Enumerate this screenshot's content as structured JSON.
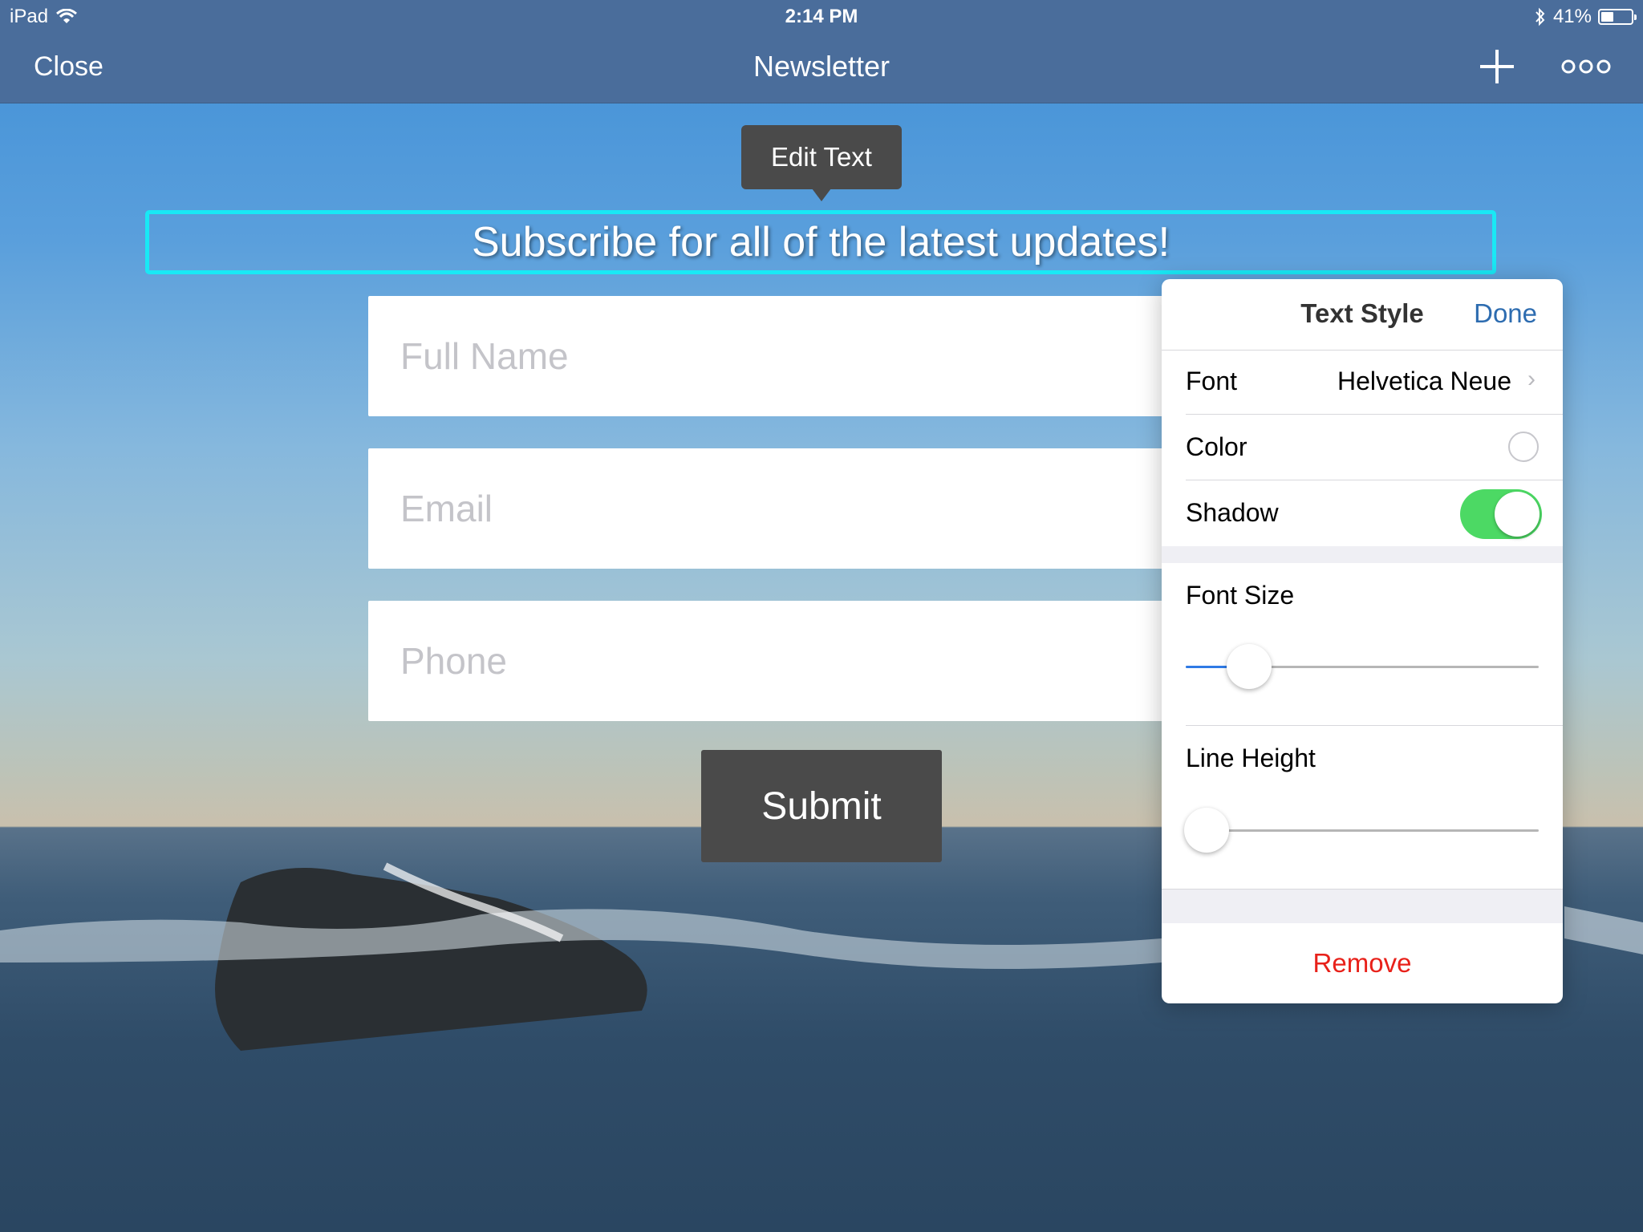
{
  "status_bar": {
    "device": "iPad",
    "time": "2:14 PM",
    "battery": "41%",
    "battery_level": 0.41
  },
  "nav": {
    "close_label": "Close",
    "title": "Newsletter"
  },
  "canvas": {
    "tooltip": "Edit Text",
    "headline": "Subscribe for all of the latest updates!",
    "fields": [
      {
        "placeholder": "Full Name"
      },
      {
        "placeholder": "Email"
      },
      {
        "placeholder": "Phone"
      }
    ],
    "submit_label": "Submit"
  },
  "text_style_panel": {
    "title": "Text Style",
    "done_label": "Done",
    "font_label": "Font",
    "font_value": "Helvetica Neue",
    "color_label": "Color",
    "shadow_label": "Shadow",
    "shadow_on": true,
    "font_size_label": "Font Size",
    "font_size_level": 0.18,
    "line_height_label": "Line Height",
    "line_height_level": 0.06,
    "remove_label": "Remove"
  },
  "colors": {
    "bar": "#4a6d9b",
    "selection": "#19e8f5",
    "toggle_on": "#4cd964",
    "accent": "#2d6cb0",
    "destructive": "#e8211a"
  }
}
